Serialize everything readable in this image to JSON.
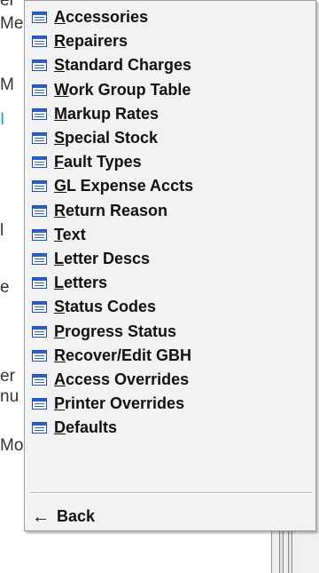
{
  "background": {
    "fragments": [
      {
        "text": "er",
        "accent": false
      },
      {
        "text": "Me",
        "accent": false
      },
      {
        "text": "M",
        "accent": false
      },
      {
        "text": "I",
        "accent": true
      },
      {
        "text": "l",
        "accent": false
      },
      {
        "text": "e",
        "accent": false
      },
      {
        "text": "er",
        "accent": false
      },
      {
        "text": "nu",
        "accent": false
      },
      {
        "text": "Mo",
        "accent": false
      }
    ]
  },
  "menu": {
    "items": [
      {
        "mnemonic": "A",
        "rest": "ccessories",
        "icon": "table-icon"
      },
      {
        "mnemonic": "R",
        "rest": "epairers",
        "icon": "table-icon"
      },
      {
        "mnemonic": "S",
        "rest": "tandard Charges",
        "icon": "table-icon"
      },
      {
        "mnemonic": "W",
        "rest": "ork Group Table",
        "icon": "table-icon"
      },
      {
        "mnemonic": "M",
        "rest": "arkup Rates",
        "icon": "table-icon"
      },
      {
        "mnemonic": "S",
        "rest": "pecial Stock",
        "icon": "table-icon"
      },
      {
        "mnemonic": "F",
        "rest": "ault Types",
        "icon": "table-icon"
      },
      {
        "mnemonic": "G",
        "rest": "L Expense Accts",
        "icon": "table-icon"
      },
      {
        "mnemonic": "R",
        "rest": "eturn Reason",
        "icon": "table-icon"
      },
      {
        "mnemonic": "T",
        "rest": "ext",
        "icon": "table-icon"
      },
      {
        "mnemonic": "L",
        "rest": "etter Descs",
        "icon": "table-icon"
      },
      {
        "mnemonic": "L",
        "rest": "etters",
        "icon": "table-icon"
      },
      {
        "mnemonic": "S",
        "rest": "tatus Codes",
        "icon": "table-icon"
      },
      {
        "mnemonic": "P",
        "rest": "rogress Status",
        "icon": "table-icon"
      },
      {
        "mnemonic": "R",
        "rest": "ecover/Edit GBH",
        "icon": "table-icon"
      },
      {
        "mnemonic": "A",
        "rest": "ccess Overrides",
        "icon": "table-icon"
      },
      {
        "mnemonic": "P",
        "rest": "rinter Overrides",
        "icon": "table-icon"
      },
      {
        "mnemonic": "D",
        "rest": "efaults",
        "icon": "table-icon"
      }
    ],
    "back": {
      "arrow": "←",
      "label": "Back",
      "icon": "back-arrow-icon"
    }
  },
  "colors": {
    "menu_bg": "#f2f2f2",
    "icon_blue": "#2b60c8",
    "text": "#111111"
  }
}
